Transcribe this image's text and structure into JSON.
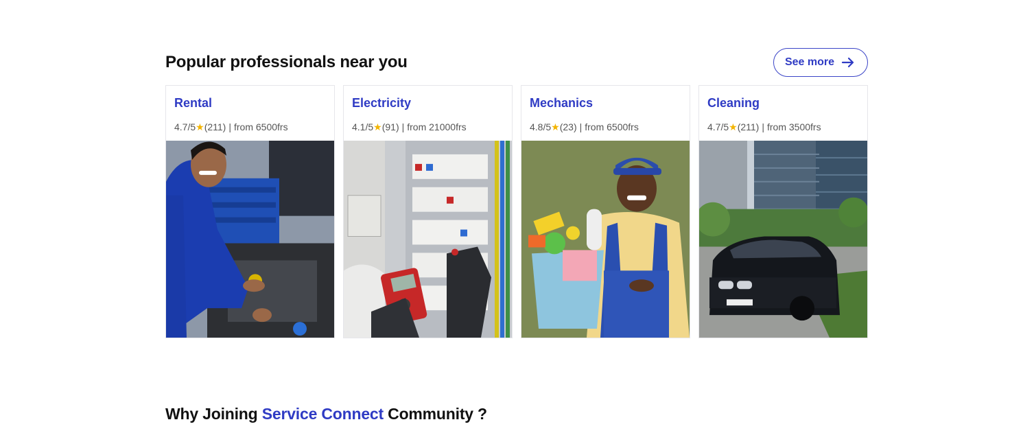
{
  "popular": {
    "title": "Popular professionals near you",
    "see_more_label": "See more",
    "cards": [
      {
        "title": "Rental",
        "rating": "4.7/5",
        "reviews": "(211)",
        "price": "from 6500frs",
        "photo": "mechanic-repairing-engine-photo"
      },
      {
        "title": "Electricity",
        "rating": "4.1/5",
        "reviews": "(91)",
        "price": "from 21000frs",
        "photo": "electrician-testing-panel-photo"
      },
      {
        "title": "Mechanics",
        "rating": "4.8/5",
        "reviews": "(23)",
        "price": "from 6500frs",
        "photo": "cleaner-holding-bucket-photo"
      },
      {
        "title": "Cleaning",
        "rating": "4.7/5",
        "reviews": "(211)",
        "price": "from 3500frs",
        "photo": "black-car-near-buildings-photo"
      }
    ]
  },
  "why": {
    "prefix": "Why Joining",
    "accent": "Service Connect",
    "suffix": "Community ?"
  },
  "colors": {
    "accent": "#2f3bc4",
    "star": "#f3b400",
    "text": "#111111",
    "muted": "#555555",
    "border": "#e6e6ea"
  },
  "icons": {
    "see_more": "arrow-right-icon",
    "rating": "star-icon"
  }
}
